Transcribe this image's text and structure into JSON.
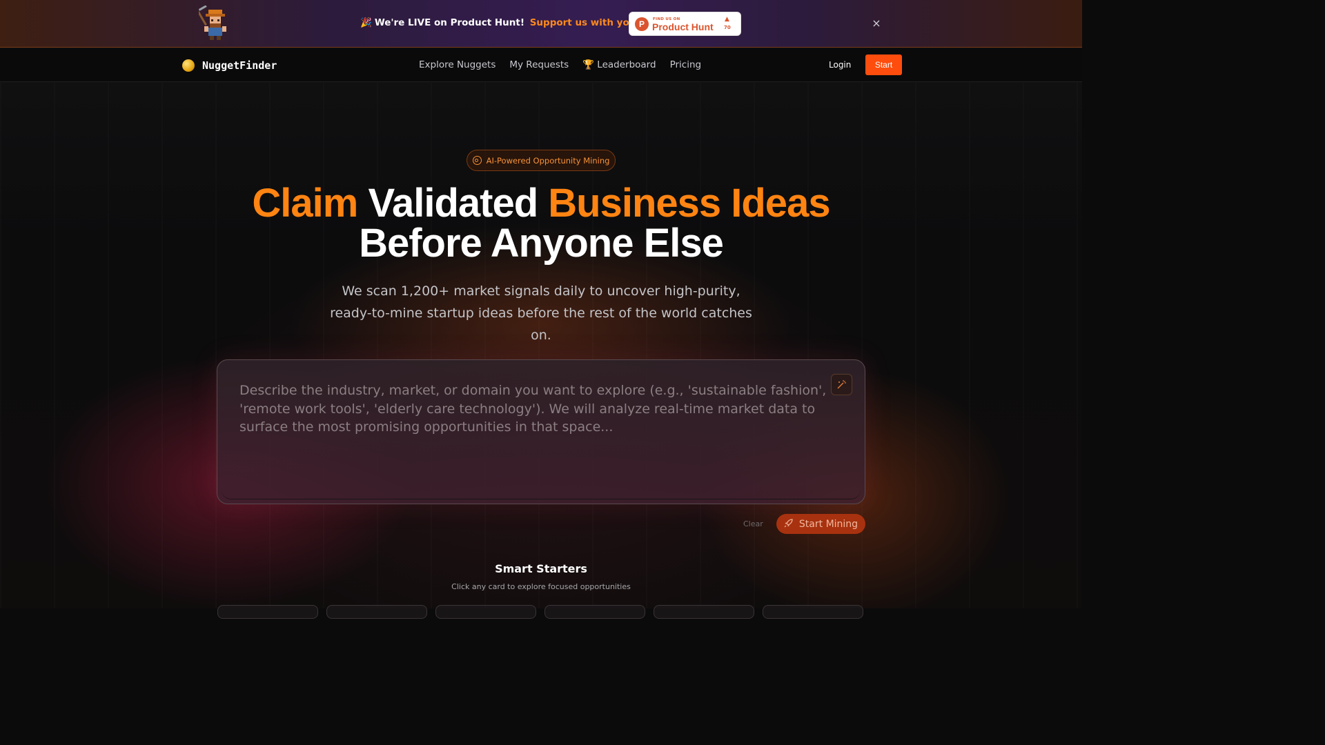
{
  "banner": {
    "party_emoji": "🎉",
    "live_text": "We're LIVE on Product Hunt!",
    "upvote_text": "Support us with your upvote",
    "product_hunt": {
      "small_label": "FIND US ON",
      "name": "Product Hunt",
      "logo_letter": "P",
      "upvote_arrow": "▲",
      "count": "70"
    },
    "close_symbol": "×"
  },
  "nav": {
    "brand": "NuggetFinder",
    "links": [
      "Explore Nuggets",
      "My Requests",
      "🏆 Leaderboard",
      "Pricing"
    ],
    "login": "Login",
    "start": "Start"
  },
  "hero": {
    "pill": "AI-Powered Opportunity Mining",
    "headline": {
      "word1": "Claim",
      "word2": "Validated",
      "word3": "Business Ideas",
      "line2": "Before Anyone Else"
    },
    "subhead": "We scan 1,200+ market signals daily to uncover high-purity, ready-to-mine startup ideas before the rest of the world catches on."
  },
  "search": {
    "placeholder": "Describe the industry, market, or domain you want to explore (e.g., 'sustainable fashion', 'remote work tools', 'elderly care technology'). We will analyze real-time market data to surface the most promising opportunities in that space...",
    "value": "",
    "wand_icon": "wand-sparkle-icon"
  },
  "actions": {
    "clear": "Clear",
    "start_mining": "Start Mining",
    "rocket_icon": "rocket-icon"
  },
  "starters": {
    "title": "Smart Starters",
    "subtitle": "Click any card to explore focused opportunities"
  },
  "colors": {
    "accent": "#ff8412",
    "start_button": "#ff4d0d",
    "product_hunt": "#da552f"
  }
}
